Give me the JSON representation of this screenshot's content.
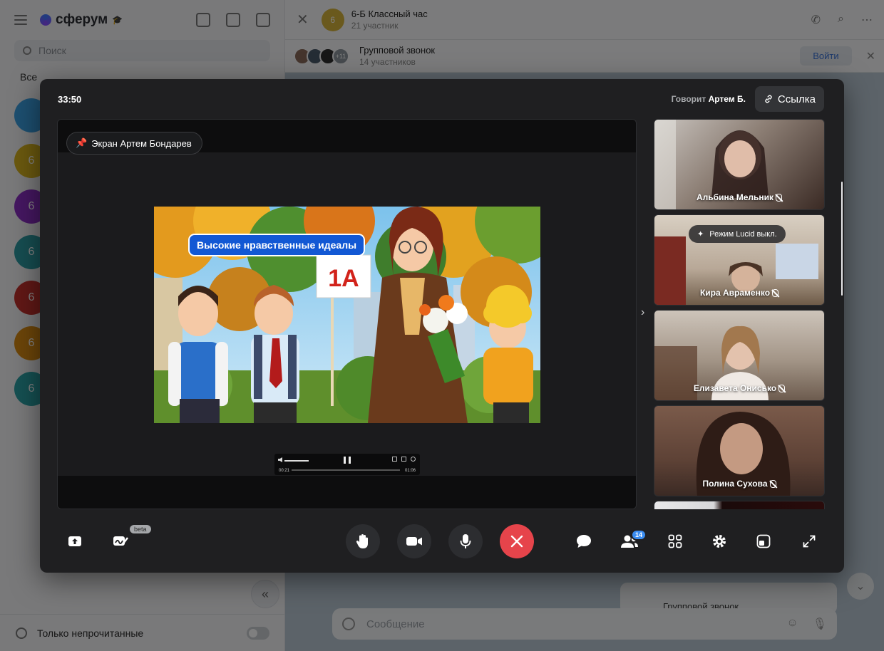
{
  "app": {
    "brand": "сферум",
    "search_placeholder": "Поиск",
    "filter_label": "Все",
    "chat_avatar_letter": "6",
    "unread_only_label": "Только непрочитанные"
  },
  "chat": {
    "title": "6-Б Классный час",
    "subtitle": "21 участник",
    "avatar_letter": "6"
  },
  "call_bar": {
    "title": "Групповой звонок",
    "subtitle": "14 участников",
    "more_count": "+11",
    "join_label": "Войти"
  },
  "composer": {
    "placeholder": "Сообщение",
    "card_text": "Групповой звонок"
  },
  "call": {
    "timer": "33:50",
    "speaking_prefix": "Говорит",
    "speaking_name": "Артем Б.",
    "link_label": "Ссылка",
    "screen_label": "Экран Артем Бондарев",
    "slide_title": "Высокие нравственные идеалы",
    "slide_sign": "1А",
    "player": {
      "current": "00:21",
      "total": "01:06",
      "progress": 0.28
    },
    "lucid_label": "Режим Lucid выкл.",
    "participants": [
      {
        "name": "Альбина Мельник",
        "muted": true
      },
      {
        "name": "Кира Авраменко",
        "muted": true
      },
      {
        "name": "Елизавета Онисько",
        "muted": true
      },
      {
        "name": "Полина Сухова",
        "muted": true
      }
    ],
    "beta_label": "beta",
    "participants_count": "14"
  },
  "colors": {
    "end_call": "#e6444b",
    "accent": "#3a8cf0",
    "slide_title_bg": "#1258d4"
  },
  "icons": [
    "pin-icon",
    "link-icon",
    "upload-screen-icon",
    "whiteboard-icon",
    "raise-hand-icon",
    "camera-icon",
    "microphone-icon",
    "end-call-icon",
    "chat-icon",
    "participants-icon",
    "grid-layout-icon",
    "settings-icon",
    "pip-icon",
    "fullscreen-icon",
    "mic-off-icon",
    "sparkle-icon"
  ]
}
